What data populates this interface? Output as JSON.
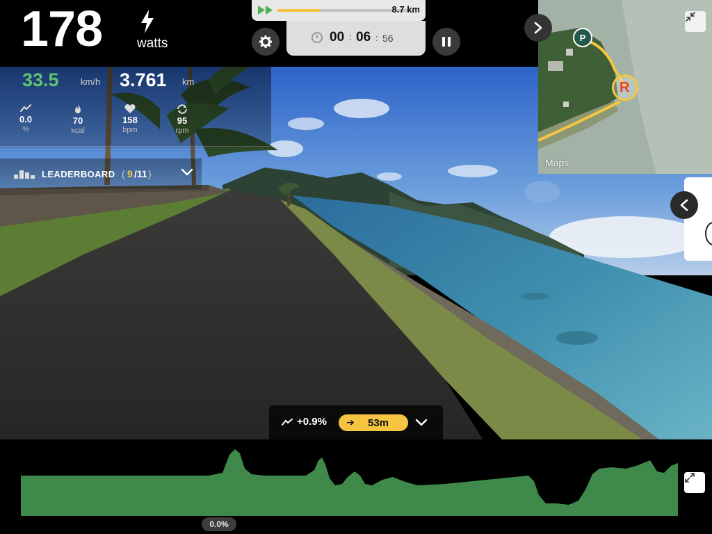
{
  "power": {
    "value": "178",
    "unit": "watts",
    "icon": "lightning-icon"
  },
  "ride": {
    "speed": "33.5",
    "speed_unit": "km/h",
    "distance": "3.761",
    "distance_unit": "km",
    "progress_fraction": 0.32
  },
  "stats": [
    {
      "icon": "slope-icon",
      "value": "0.0",
      "unit": "%"
    },
    {
      "icon": "flame-icon",
      "value": "70",
      "unit": "kcal"
    },
    {
      "icon": "heart-icon",
      "value": "158",
      "unit": "bpm"
    },
    {
      "icon": "cadence-icon",
      "value": "95",
      "unit": "rpm"
    }
  ],
  "route": {
    "total_distance": "8.7 km"
  },
  "timer": {
    "hours": "00",
    "minutes": "06",
    "seconds": "56",
    "sep_major": ":",
    "sep_minor": ":"
  },
  "leaderboard": {
    "label": "LEADERBOARD",
    "position": "9",
    "total": "/11",
    "open_paren": "(",
    "close_paren": ")"
  },
  "map": {
    "label": "Maps",
    "parking_marker": "P",
    "rider_marker": "R"
  },
  "grade": {
    "value": "+0.9%",
    "ahead_arrow": "➔",
    "ahead_distance": "53m"
  },
  "profile": {
    "current_grade": "0.0%"
  },
  "colors": {
    "accent_yellow": "#f5c542",
    "speed_green": "#5ec46f",
    "profile_green": "#3f8a4a",
    "panel_gray": "#e8e8e8"
  }
}
